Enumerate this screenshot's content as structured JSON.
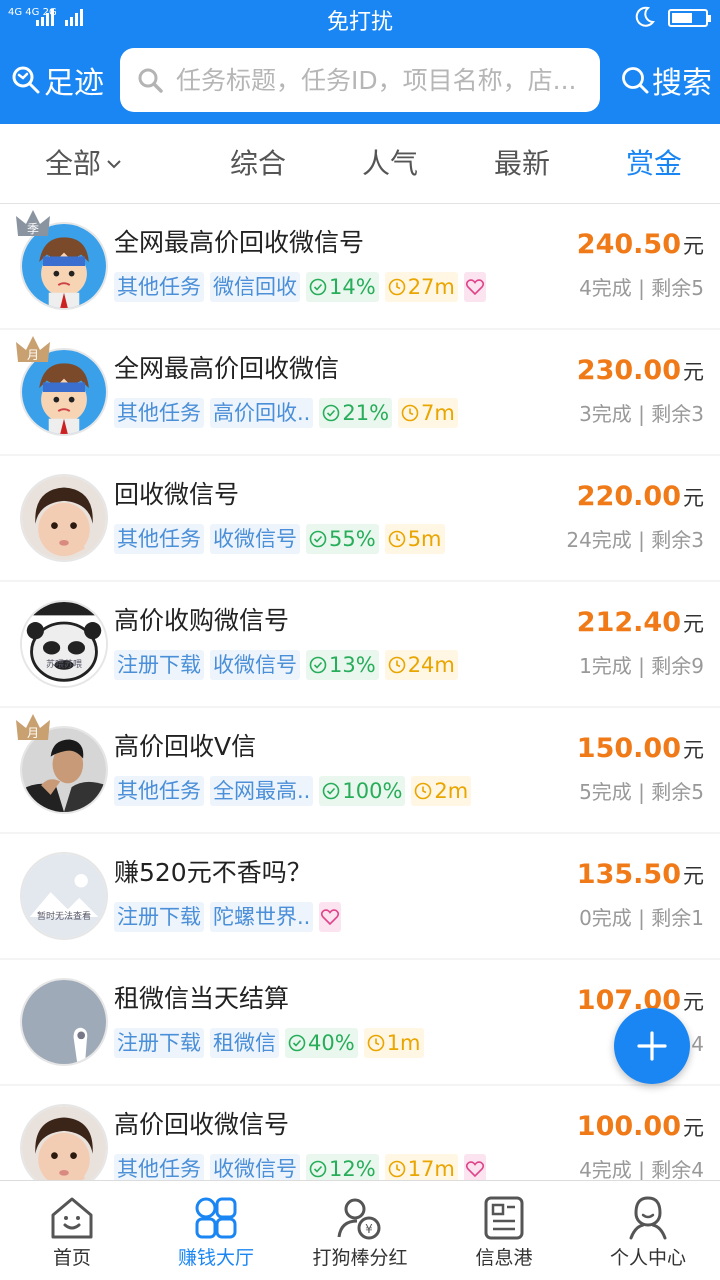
{
  "status_bar": {
    "signal_text": "4G 4G 2G",
    "center_text": "免打扰"
  },
  "header": {
    "footprint_label": "足迹",
    "search_placeholder": "任务标题，任务ID，项目名称，店...",
    "search_button_label": "搜索"
  },
  "sort_tabs": [
    {
      "label": "全部",
      "active": false
    },
    {
      "label": "综合",
      "active": false
    },
    {
      "label": "人气",
      "active": false
    },
    {
      "label": "最新",
      "active": false
    },
    {
      "label": "赏金",
      "active": true
    }
  ],
  "tasks": [
    {
      "title": "全网最高价回收微信号",
      "category": "其他任务",
      "project": "微信回收",
      "rate": "14%",
      "time": "27m",
      "heart": true,
      "price": "240.50",
      "unit": "元",
      "done": "4完成",
      "remain": "剩余5",
      "crown_text": "季"
    },
    {
      "title": "全网最高价回收微信",
      "category": "其他任务",
      "project": "高价回收..",
      "rate": "21%",
      "time": "7m",
      "heart": false,
      "price": "230.00",
      "unit": "元",
      "done": "3完成",
      "remain": "剩余3",
      "crown_text": "月"
    },
    {
      "title": "回收微信号",
      "category": "其他任务",
      "project": "收微信号",
      "rate": "55%",
      "time": "5m",
      "heart": false,
      "price": "220.00",
      "unit": "元",
      "done": "24完成",
      "remain": "剩余3",
      "crown_text": ""
    },
    {
      "title": "高价收购微信号",
      "category": "注册下载",
      "project": "收微信号",
      "rate": "13%",
      "time": "24m",
      "heart": false,
      "price": "212.40",
      "unit": "元",
      "done": "1完成",
      "remain": "剩余9",
      "crown_text": "",
      "avatar_text": "苏喂苏喂"
    },
    {
      "title": "高价回收V信",
      "category": "其他任务",
      "project": "全网最高..",
      "rate": "100%",
      "time": "2m",
      "heart": false,
      "price": "150.00",
      "unit": "元",
      "done": "5完成",
      "remain": "剩余5",
      "crown_text": "月"
    },
    {
      "title": "赚520元不香吗？",
      "category": "注册下载",
      "project": "陀螺世界..",
      "rate": "",
      "time": "",
      "heart": true,
      "price": "135.50",
      "unit": "元",
      "done": "0完成",
      "remain": "剩余1",
      "crown_text": "",
      "avatar_text": "暂时无法查看"
    },
    {
      "title": "租微信当天结算",
      "category": "注册下载",
      "project": "租微信",
      "rate": "40%",
      "time": "1m",
      "heart": false,
      "price": "107.00",
      "unit": "元",
      "done": "4完成",
      "remain": "4",
      "crown_text": ""
    },
    {
      "title": "高价回收微信号",
      "category": "其他任务",
      "project": "收微信号",
      "rate": "12%",
      "time": "17m",
      "heart": true,
      "price": "100.00",
      "unit": "元",
      "done": "4完成",
      "remain": "剩余4",
      "crown_text": ""
    }
  ],
  "bottom_nav": [
    {
      "label": "首页",
      "active": false
    },
    {
      "label": "赚钱大厅",
      "active": true
    },
    {
      "label": "打狗棒分红",
      "active": false
    },
    {
      "label": "信息港",
      "active": false
    },
    {
      "label": "个人中心",
      "active": false
    }
  ],
  "colors": {
    "primary": "#1a86f3",
    "price": "#f07a17",
    "rate": "#28ad5a",
    "time": "#e9a500"
  }
}
